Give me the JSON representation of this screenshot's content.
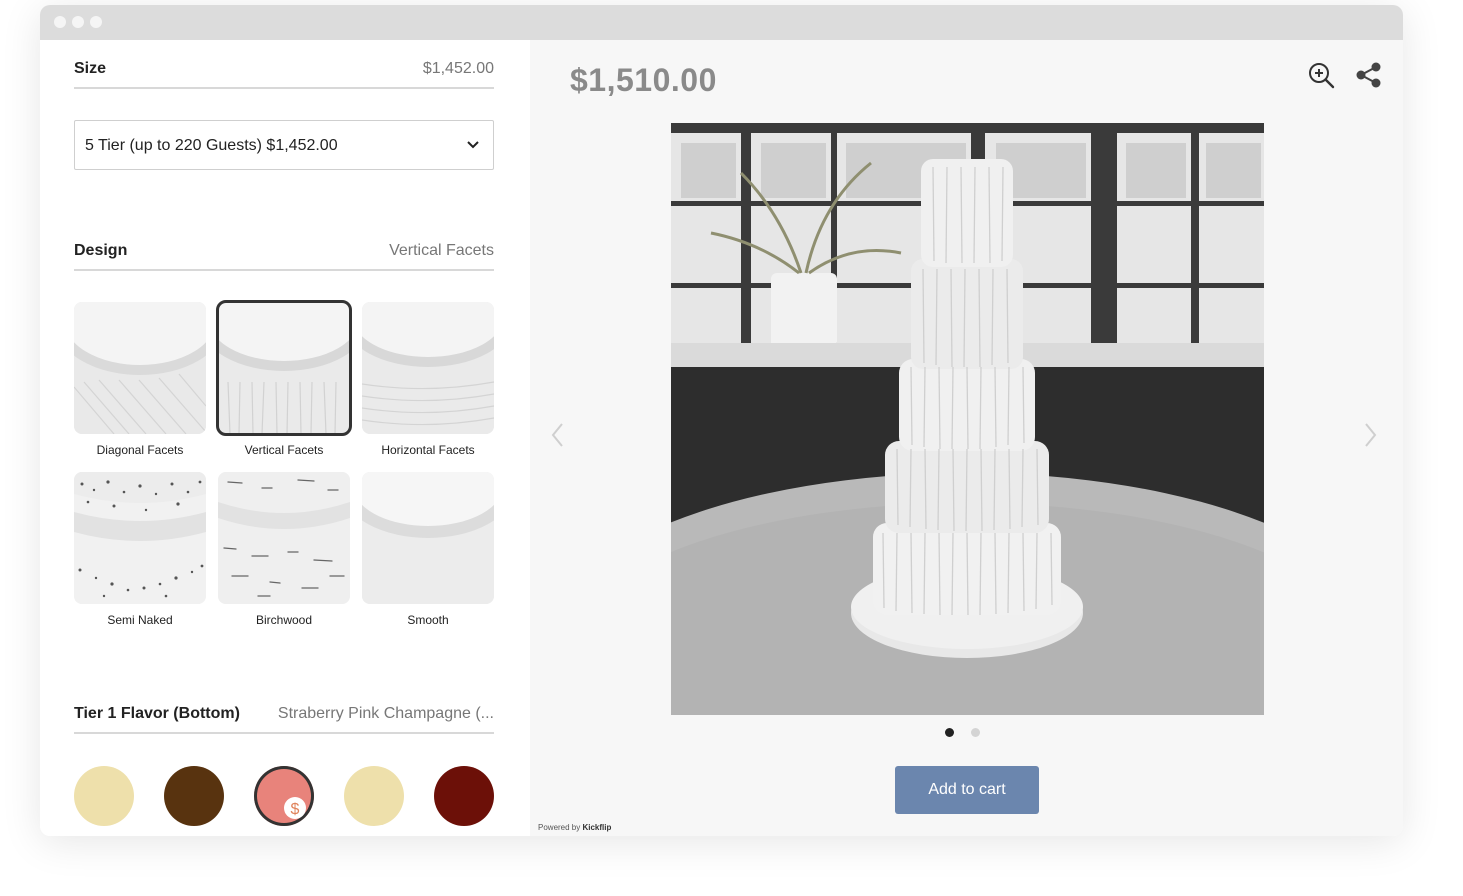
{
  "size": {
    "title": "Size",
    "price": "$1,452.00",
    "selected_option": "5 Tier (up to 220 Guests) $1,452.00"
  },
  "design": {
    "title": "Design",
    "selected": "Vertical Facets",
    "options": [
      {
        "label": "Diagonal Facets"
      },
      {
        "label": "Vertical Facets"
      },
      {
        "label": "Horizontal Facets"
      },
      {
        "label": "Semi Naked"
      },
      {
        "label": "Birchwood"
      },
      {
        "label": "Smooth"
      }
    ]
  },
  "flavor": {
    "title": "Tier 1 Flavor (Bottom)",
    "selected": "Straberry Pink Champagne (...",
    "swatches": [
      {
        "color": "#eee0ab"
      },
      {
        "color": "#58330f"
      },
      {
        "color": "#e8837b",
        "badge": "$"
      },
      {
        "color": "#eee0ab"
      },
      {
        "color": "#6c1008"
      }
    ]
  },
  "product": {
    "price": "$1,510.00",
    "add_to_cart": "Add to cart",
    "powered_by_prefix": "Powered by",
    "powered_by_brand": "Kickflip",
    "current_image": 1,
    "image_count": 2
  },
  "icons": {
    "zoom": "zoom-in-icon",
    "share": "share-icon",
    "dropdown": "chevron-down-icon",
    "prev": "chevron-left-icon",
    "next": "chevron-right-icon"
  },
  "colors": {
    "button": "#6b86ae",
    "price": "#8a8a8a"
  }
}
